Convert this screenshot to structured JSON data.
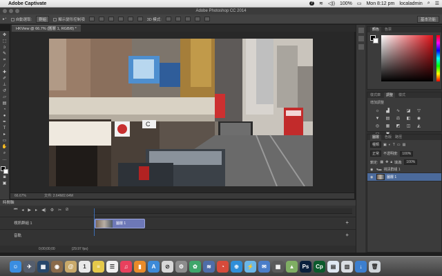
{
  "menubar": {
    "app_name": "Adobe Captivate",
    "badge": "7",
    "battery": "100%",
    "clock": "Mon 8:12 pm",
    "user": "localadmin"
  },
  "window": {
    "title": "Adobe Photoshop CC 2014"
  },
  "options_bar": {
    "auto_select_label": "自動選取:",
    "auto_select_value": "群組",
    "show_transform_label": "顯示變形控制項",
    "mode_3d_label": "3D 模式:",
    "workspace": "基本功能"
  },
  "document": {
    "tab_label": "HKView @ 66.7% (圖層 1, RGB/8) *",
    "zoom": "66.67%",
    "file_info": "文件: 2.64M/2.64M"
  },
  "photo_labels": {
    "sign_1": "C",
    "sign_2": "C"
  },
  "timeline": {
    "title": "時間軸",
    "track_1_label": "視訊群組 1",
    "clip_label": "圖層 1",
    "audio_label": "音軌",
    "timecode": "0;00;00;00",
    "fps": "(29.97 fps)"
  },
  "color_panel": {
    "tabs": [
      "顏色",
      "色票"
    ]
  },
  "adjust_panel": {
    "tabs": [
      "樣式庫",
      "調整",
      "樣式"
    ],
    "title": "增加調整",
    "icons": [
      "sun",
      "levels",
      "curves",
      "exposure",
      "triangle",
      "vibrance",
      "hue",
      "balance",
      "bw",
      "camera",
      "channel",
      "grid",
      "invert",
      "posterize",
      "threshold",
      "gradient",
      "selective"
    ]
  },
  "layers_panel": {
    "tabs": [
      "圖層",
      "色版",
      "路徑"
    ],
    "kind_label": "種類",
    "blend_mode": "正常",
    "opacity_label": "不透明度:",
    "opacity_value": "100%",
    "lock_label": "鎖定:",
    "fill_label": "填滿:",
    "fill_value": "100%",
    "group_name": "視訊群組 1",
    "layer_name": "圖層 1"
  },
  "dock_apps": [
    {
      "name": "finder",
      "color": "#3a8de0",
      "glyph": "☺"
    },
    {
      "name": "launchpad",
      "color": "#555e6d",
      "glyph": "✈"
    },
    {
      "name": "mission-control",
      "color": "#27476b",
      "glyph": "▦"
    },
    {
      "name": "photo",
      "color": "#8a6a4a",
      "glyph": "◉"
    },
    {
      "name": "contacts",
      "color": "#c9a96a",
      "glyph": "@"
    },
    {
      "name": "calendar",
      "color": "#e9e9e9",
      "glyph": "1"
    },
    {
      "name": "notes",
      "color": "#e5c94a",
      "glyph": "≡"
    },
    {
      "name": "reminders",
      "color": "#f0f0f0",
      "glyph": "☰"
    },
    {
      "name": "itunes",
      "color": "#e8405d",
      "glyph": "♫"
    },
    {
      "name": "ibooks",
      "color": "#e88b2a",
      "glyph": "▮"
    },
    {
      "name": "appstore",
      "color": "#3d8ad8",
      "glyph": "A"
    },
    {
      "name": "parental",
      "color": "#d8d8d8",
      "glyph": "⊘"
    },
    {
      "name": "prefs",
      "color": "#8d8d8d",
      "glyph": "⚙"
    },
    {
      "name": "pinwheel",
      "color": "#3fa66a",
      "glyph": "✿"
    },
    {
      "name": "lines",
      "color": "#4e6da8",
      "glyph": "≋"
    },
    {
      "name": "chrome",
      "color": "#d74b3b",
      "glyph": "◔"
    },
    {
      "name": "safari",
      "color": "#2f8ed8",
      "glyph": "⊕"
    },
    {
      "name": "thunder",
      "color": "#6bb7e8",
      "glyph": "⚡"
    },
    {
      "name": "mail",
      "color": "#4a7dc9",
      "glyph": "✉"
    },
    {
      "name": "calculator",
      "color": "#5a5a5a",
      "glyph": "▦"
    },
    {
      "name": "maps",
      "color": "#7fae63",
      "glyph": "▲"
    },
    {
      "name": "photoshop",
      "color": "#0a1f3c",
      "glyph": "Ps"
    },
    {
      "name": "captivate",
      "color": "#0b5a2c",
      "glyph": "Cp"
    },
    {
      "name": "document",
      "color": "#dfe8f2",
      "glyph": "▤"
    },
    {
      "name": "folder",
      "color": "#d9dde2",
      "glyph": "▥"
    },
    {
      "name": "downloads",
      "color": "#3c7fcf",
      "glyph": "↓"
    },
    {
      "name": "trash",
      "color": "#cfd5da",
      "glyph": "🗑"
    }
  ]
}
